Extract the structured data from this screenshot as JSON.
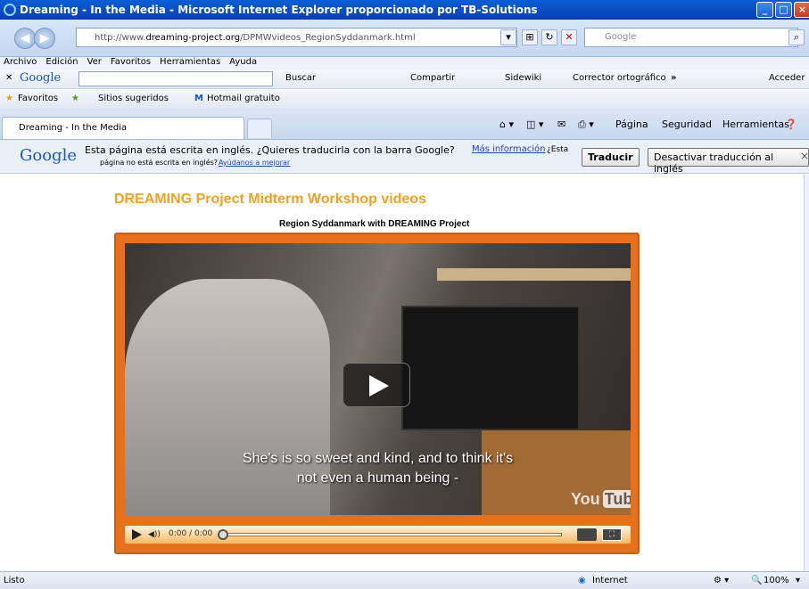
{
  "window": {
    "title": "Dreaming - In the Media - Microsoft Internet Explorer proporcionado por TB-Solutions",
    "controls": {
      "minimize": "_",
      "maximize": "□",
      "close": "×"
    }
  },
  "address_bar": {
    "url_prefix": "http://www.",
    "url_domain": "dreaming-project.org",
    "url_path": "/DPMWvideos_RegionSyddanmark.html",
    "search_placeholder": "Google"
  },
  "menu": [
    "Archivo",
    "Edición",
    "Ver",
    "Favoritos",
    "Herramientas",
    "Ayuda"
  ],
  "google_toolbar": {
    "brand": "Google",
    "items": [
      "Buscar",
      "Compartir",
      "Sidewiki",
      "Corrector ortográfico",
      "Acceder"
    ],
    "more": "»"
  },
  "favorites_bar": {
    "favorites": "Favoritos",
    "suggested": "Sitios sugeridos",
    "hotmail": "Hotmail gratuito"
  },
  "tab": {
    "label": "Dreaming - In the Media"
  },
  "command_bar": [
    "Página",
    "Seguridad",
    "Herramientas"
  ],
  "translate_bar": {
    "logo": "Google",
    "message": "Esta página está escrita en inglés. ¿Quieres traducirla con la barra Google?",
    "more_info": "Más información",
    "not_english_prefix": "¿Esta",
    "not_english_line2": "página no está escrita en inglés?",
    "help_link": "Ayúdanos a mejorar",
    "translate_button": "Traducir",
    "disable_button": "Desactivar traducción al inglés",
    "close": "×"
  },
  "page": {
    "heading": "DREAMING Project Midterm Workshop videos",
    "video_title": "Region Syddanmark with DREAMING Project",
    "subtitle_line1": "She's is so sweet and kind, and to think it's",
    "subtitle_line2": "not even a human being -",
    "youtube_logo_you": "You",
    "youtube_logo_tube": "Tube",
    "time": "0:00 / 0:00"
  },
  "status_bar": {
    "text": "Listo",
    "zone": "Internet",
    "zoom": "100%"
  }
}
